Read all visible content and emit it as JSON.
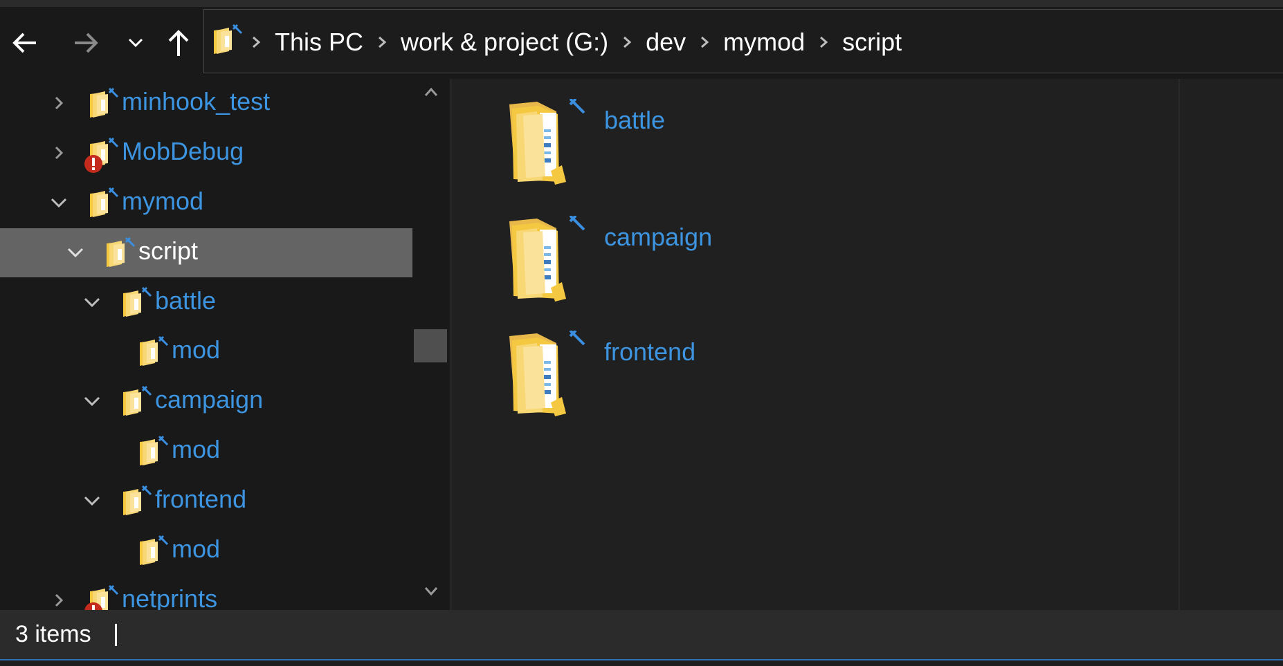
{
  "window": {
    "accent_color": "#3d94e0",
    "selection_color": "#646464"
  },
  "nav": {
    "back_icon": "arrow-left-icon",
    "forward_icon": "arrow-right-icon",
    "recent_icon": "chevron-down-icon",
    "up_icon": "arrow-up-icon"
  },
  "address": {
    "icon": "shortcut-folder-icon",
    "breadcrumbs": [
      "This PC",
      "work & project (G:)",
      "dev",
      "mymod",
      "script"
    ]
  },
  "tree": {
    "items": [
      {
        "label": "minhook_test",
        "expanded": false,
        "status": "synced"
      },
      {
        "label": "MobDebug",
        "expanded": false,
        "status": "error"
      },
      {
        "label": "mymod",
        "expanded": true,
        "status": "synced"
      },
      {
        "label": "script",
        "expanded": true,
        "selected": true,
        "status": "synced"
      },
      {
        "label": "battle",
        "expanded": true,
        "status": "synced"
      },
      {
        "label": "mod",
        "status": "synced"
      },
      {
        "label": "campaign",
        "expanded": true,
        "status": "synced"
      },
      {
        "label": "mod",
        "status": "synced"
      },
      {
        "label": "frontend",
        "expanded": true,
        "status": "synced"
      },
      {
        "label": "mod",
        "status": "synced"
      },
      {
        "label": "netprints",
        "expanded": false,
        "status": "error"
      }
    ]
  },
  "content": {
    "items": [
      {
        "name": "battle",
        "icon": "folder-with-files-icon"
      },
      {
        "name": "campaign",
        "icon": "folder-with-files-icon"
      },
      {
        "name": "frontend",
        "icon": "folder-with-files-icon"
      }
    ]
  },
  "status": {
    "item_count": "3 items"
  }
}
